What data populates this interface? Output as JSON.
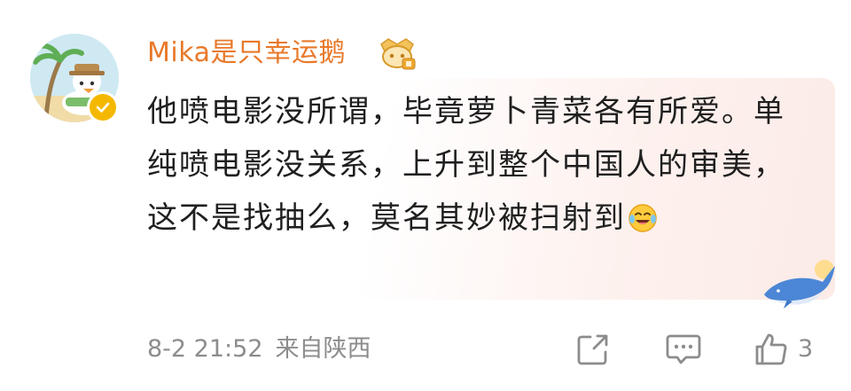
{
  "comment": {
    "username": "Mika是只幸运鹅",
    "body": {
      "text": "他喷电影没所谓，毕竟萝卜青菜各有所爱。单纯喷电影没关系，上升到整个中国人的审美，这不是找抽么，莫名其妙被扫射到",
      "emoji_icon": "laugh-cry-emoji-icon"
    },
    "time": "8-2 21:52",
    "source": "来自陕西",
    "actions": {
      "share_icon": "share-icon",
      "comment_icon": "comment-icon",
      "like_icon": "thumbs-up-icon",
      "like_count": "3"
    },
    "verified_icon": "verified-badge-icon",
    "level_badge_icon": "fan-level-badge-icon"
  },
  "colors": {
    "username": "#e8792a",
    "text": "#1f1f1f",
    "meta": "#8c8c8c",
    "verified": "#f5b800",
    "card_tint": "#fcebe7"
  }
}
